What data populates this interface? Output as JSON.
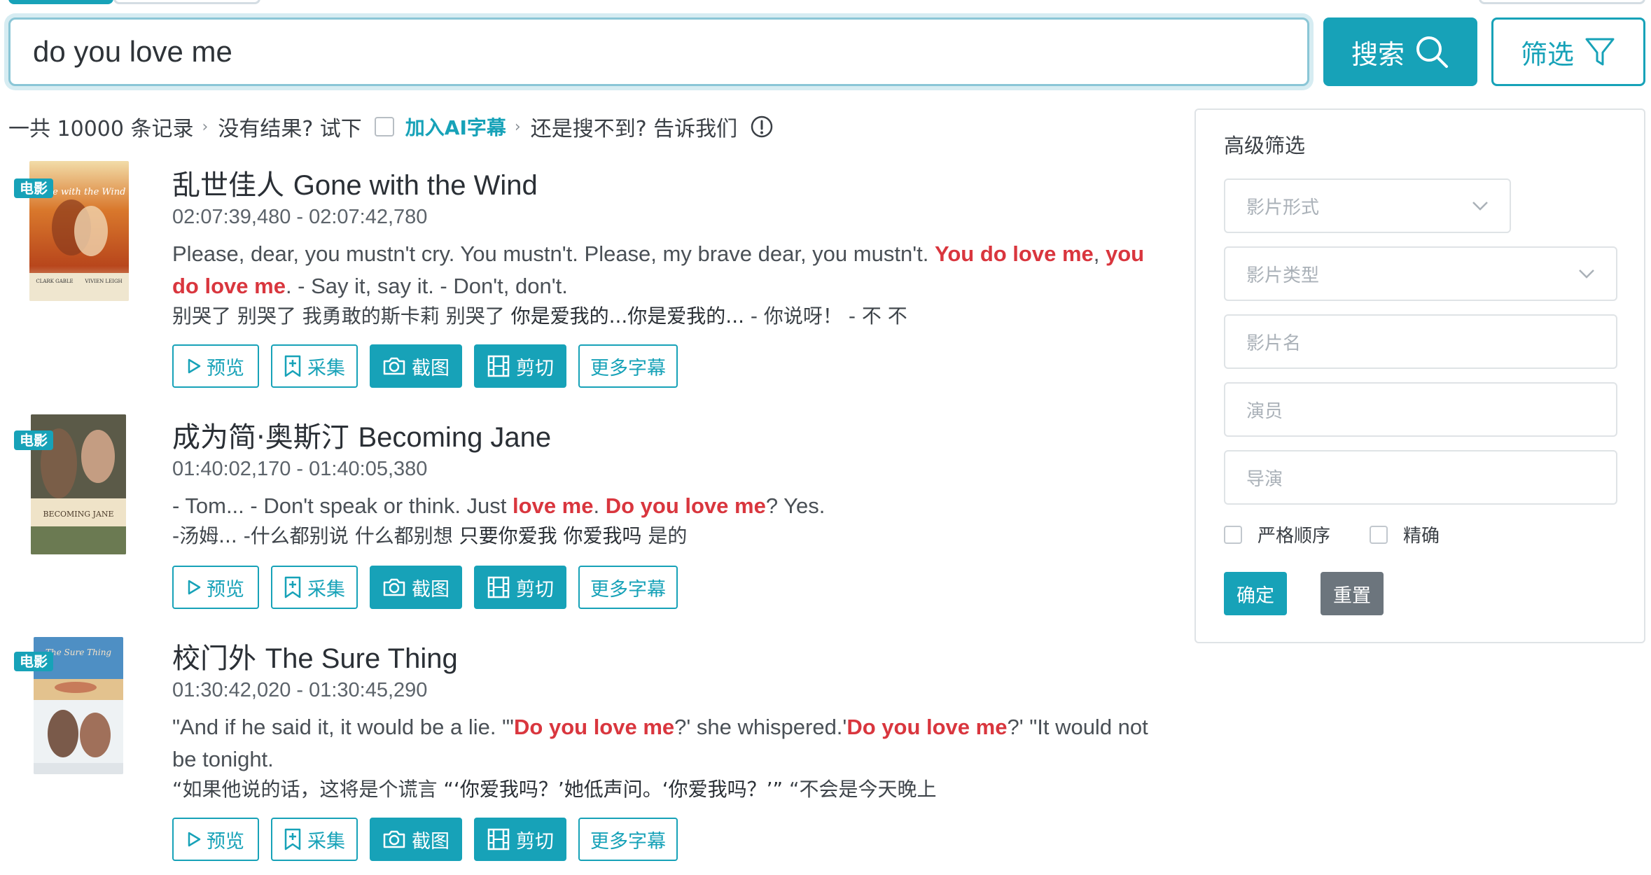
{
  "search": {
    "query": "do you love me",
    "button_label": "搜索",
    "filter_label": "筛选"
  },
  "summary": {
    "count_text": "一共 10000 条记录",
    "no_result": "没有结果? 试下",
    "ai_link": "加入AI字幕",
    "not_found": "还是搜不到? 告诉我们"
  },
  "actions": {
    "preview": "预览",
    "collect": "采集",
    "screenshot": "截图",
    "cut": "剪切",
    "more": "更多字幕"
  },
  "results": [
    {
      "badge": "电影",
      "title_zh": "乱世佳人",
      "title_en": "Gone with the Wind",
      "timecode": "02:07:39,480 - 02:07:42,780",
      "en_parts": [
        "Please, dear, you mustn't cry. You mustn't. Please, my brave dear, you mustn't.  ",
        "You do love me",
        ", ",
        "you do love me",
        ". - Say it, say it. - Don't, don't."
      ],
      "zh_parts": [
        "别哭了 别哭了 我勇敢的斯卡莉 别哭了  ",
        "你是爱我的...你是爱我的...",
        " - 你说呀！ - 不 不"
      ]
    },
    {
      "badge": "电影",
      "title_zh": "成为简·奥斯汀",
      "title_en": "Becoming Jane",
      "timecode": "01:40:02,170 - 01:40:05,380",
      "en_parts": [
        "- Tom... - Don't speak or think.  Just ",
        "love me",
        ". ",
        "Do you love me",
        "? Yes."
      ],
      "zh_parts": [
        "-汤姆... -什么都别说 什么都别想  ",
        "只要你爱我 你爱我吗",
        " 是的"
      ]
    },
    {
      "badge": "电影",
      "title_zh": "校门外",
      "title_en": "The Sure Thing",
      "timecode": "01:30:42,020 - 01:30:45,290",
      "en_parts": [
        "\"And if he said it, it would be a lie.  \"'",
        "Do you love me",
        "?' she whispered.'",
        "Do you love me",
        "?' \"It would not be tonight."
      ],
      "zh_parts": [
        "“如果他说的话，这将是个谎言  ",
        "“‘你爱我吗？’她低声问。‘你爱我吗？’”",
        " “不会是今天晚上"
      ]
    }
  ],
  "panel": {
    "title": "高级筛选",
    "form_placeholder": "影片形式",
    "type_placeholder": "影片类型",
    "name_placeholder": "影片名",
    "actor_placeholder": "演员",
    "director_placeholder": "导演",
    "strict_order": "严格顺序",
    "exact": "精确",
    "confirm": "确定",
    "reset": "重置"
  },
  "colors": {
    "accent": "#17a2b8",
    "highlight": "#d9363e",
    "reset": "#6c757d"
  }
}
